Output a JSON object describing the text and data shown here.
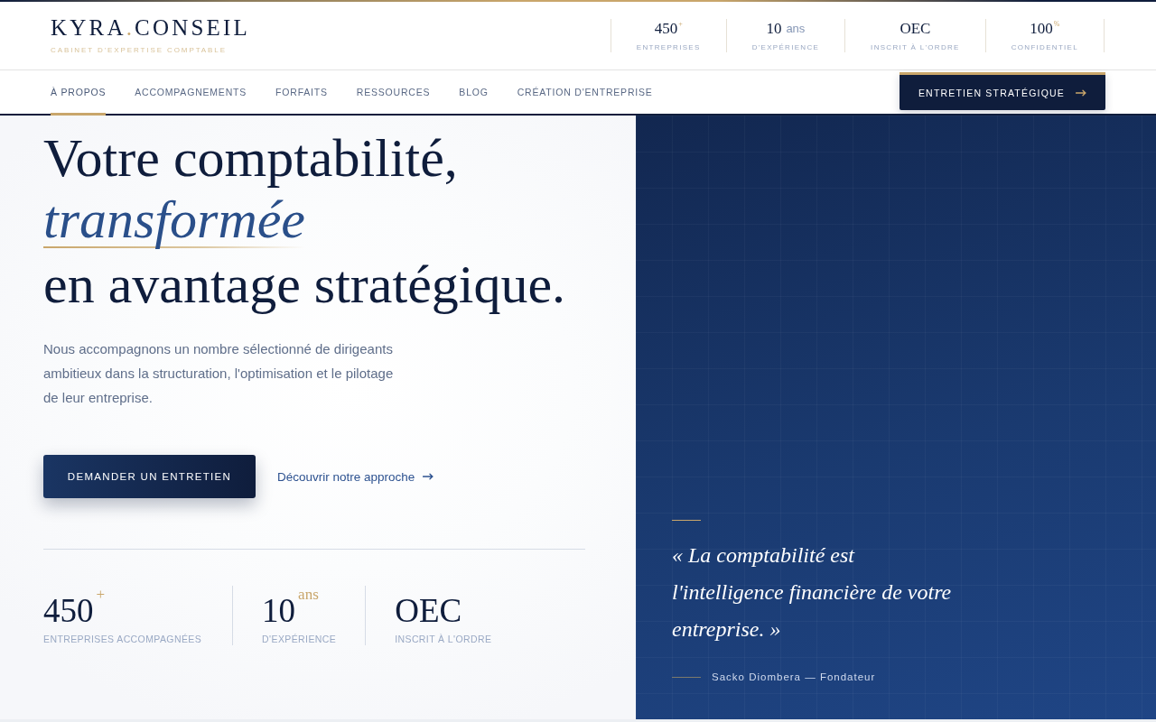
{
  "header": {
    "logo": {
      "first": "KYRA",
      "dot": ".",
      "last": "CONSEIL",
      "tagline": "CABINET D'EXPERTISE COMPTABLE"
    },
    "stats": [
      {
        "value": "450",
        "suffix": "+",
        "kind": "raised",
        "label": "ENTREPRISES"
      },
      {
        "value": "10",
        "suffix": "ans",
        "kind": "inline",
        "label": "D'EXPÉRIENCE"
      },
      {
        "value": "OEC",
        "kind": "plain",
        "label": "INSCRIT À L'ORDRE"
      },
      {
        "value": "100",
        "suffix": "%",
        "kind": "raised",
        "label": "CONFIDENTIEL"
      }
    ]
  },
  "nav": {
    "items": [
      {
        "label": "À PROPOS",
        "selected": true
      },
      {
        "label": "ACCOMPAGNEMENTS",
        "selected": false
      },
      {
        "label": "FORFAITS",
        "selected": false
      },
      {
        "label": "RESSOURCES",
        "selected": false
      },
      {
        "label": "BLOG",
        "selected": false
      },
      {
        "label": "CRÉATION D'ENTREPRISE",
        "selected": false
      }
    ],
    "cta": "ENTRETIEN STRATÉGIQUE"
  },
  "hero": {
    "headline": [
      {
        "text": "Votre comptabilité,",
        "kind": "plain"
      },
      {
        "text": "transformée",
        "kind": "accent"
      },
      {
        "text": "en avantage stratégique.",
        "kind": "plain"
      }
    ],
    "description": "Nous accompagnons un nombre sélectionné de dirigeants ambitieux dans la structuration, l'optimisation et le pilotage de leur entreprise.",
    "primary_button": "DEMANDER UN ENTRETIEN",
    "secondary_link": "Découvrir notre approche",
    "stats": [
      {
        "value": "450",
        "suffix": "+",
        "kind": "raised",
        "label": "ENTREPRISES ACCOMPAGNÉES"
      },
      {
        "value": "10",
        "suffix": "ans",
        "kind": "raised",
        "label": "D'EXPÉRIENCE"
      },
      {
        "value": "OEC",
        "kind": "plain",
        "label": "INSCRIT À L'ORDRE"
      }
    ]
  },
  "quote_panel": {
    "quote": "« La comptabilité est l'intelligence financière de votre entreprise. »",
    "attribution": "Sacko Diombera — Fondateur"
  }
}
